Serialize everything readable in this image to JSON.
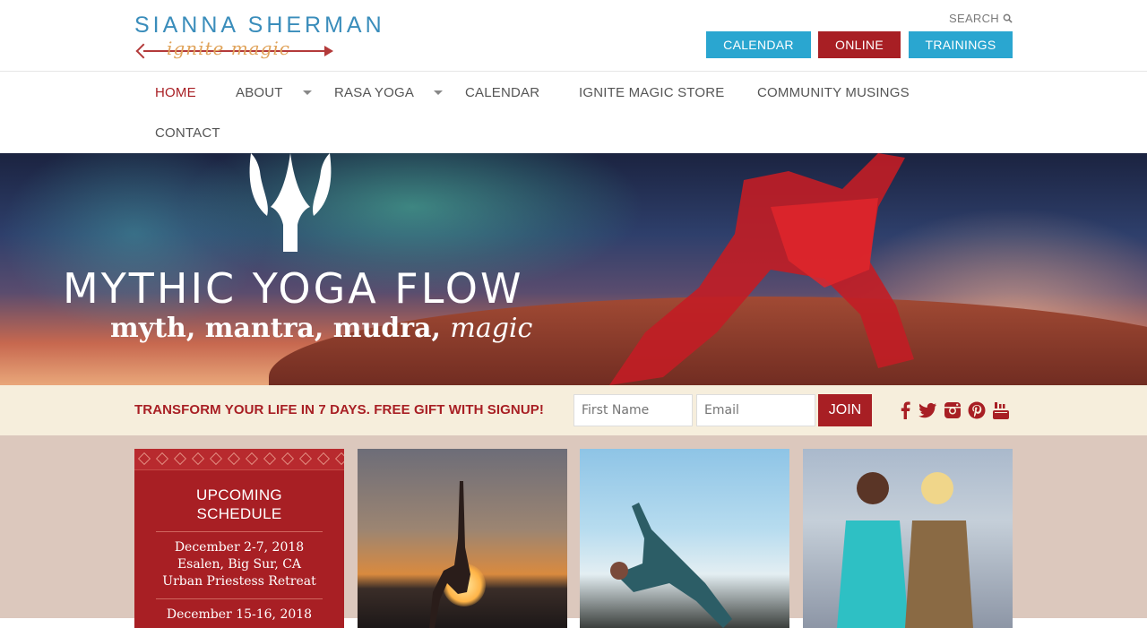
{
  "header": {
    "logo_name": "SIANNA SHERMAN",
    "logo_tagline": "ignite magic",
    "search_label": "SEARCH",
    "top_buttons": {
      "calendar": "CALENDAR",
      "online": "ONLINE",
      "trainings": "TRAININGS"
    }
  },
  "nav": {
    "items": [
      {
        "label": "HOME",
        "active": true
      },
      {
        "label": "ABOUT",
        "has_dropdown": true
      },
      {
        "label": "RASA YOGA",
        "has_dropdown": true
      },
      {
        "label": "CALENDAR"
      },
      {
        "label": "IGNITE MAGIC STORE"
      },
      {
        "label": "COMMUNITY MUSINGS"
      },
      {
        "label": "CONTACT"
      }
    ]
  },
  "hero": {
    "title": "MYTHIC YOGA FLOW",
    "subtitle": "myth, mantra, mudra,",
    "subtitle_script": "magic"
  },
  "signup": {
    "headline": "TRANSFORM YOUR LIFE IN 7 DAYS. FREE GIFT WITH SIGNUP!",
    "first_name_placeholder": "First Name",
    "email_placeholder": "Email",
    "join_label": "JOIN",
    "social": [
      "facebook-icon",
      "twitter-icon",
      "instagram-icon",
      "pinterest-icon",
      "youtube-icon"
    ]
  },
  "schedule": {
    "title_line1": "UPCOMING",
    "title_line2": "SCHEDULE",
    "entries": [
      {
        "dates": "December 2-7, 2018",
        "location": "Esalen, Big Sur, CA",
        "event": "Urban Priestess Retreat"
      },
      {
        "dates": "December 15-16, 2018"
      }
    ]
  },
  "colors": {
    "brand_red": "#a81f24",
    "brand_blue": "#2aa6d0",
    "signup_bg": "#f6eedc",
    "content_bg": "#dcc8bd"
  }
}
